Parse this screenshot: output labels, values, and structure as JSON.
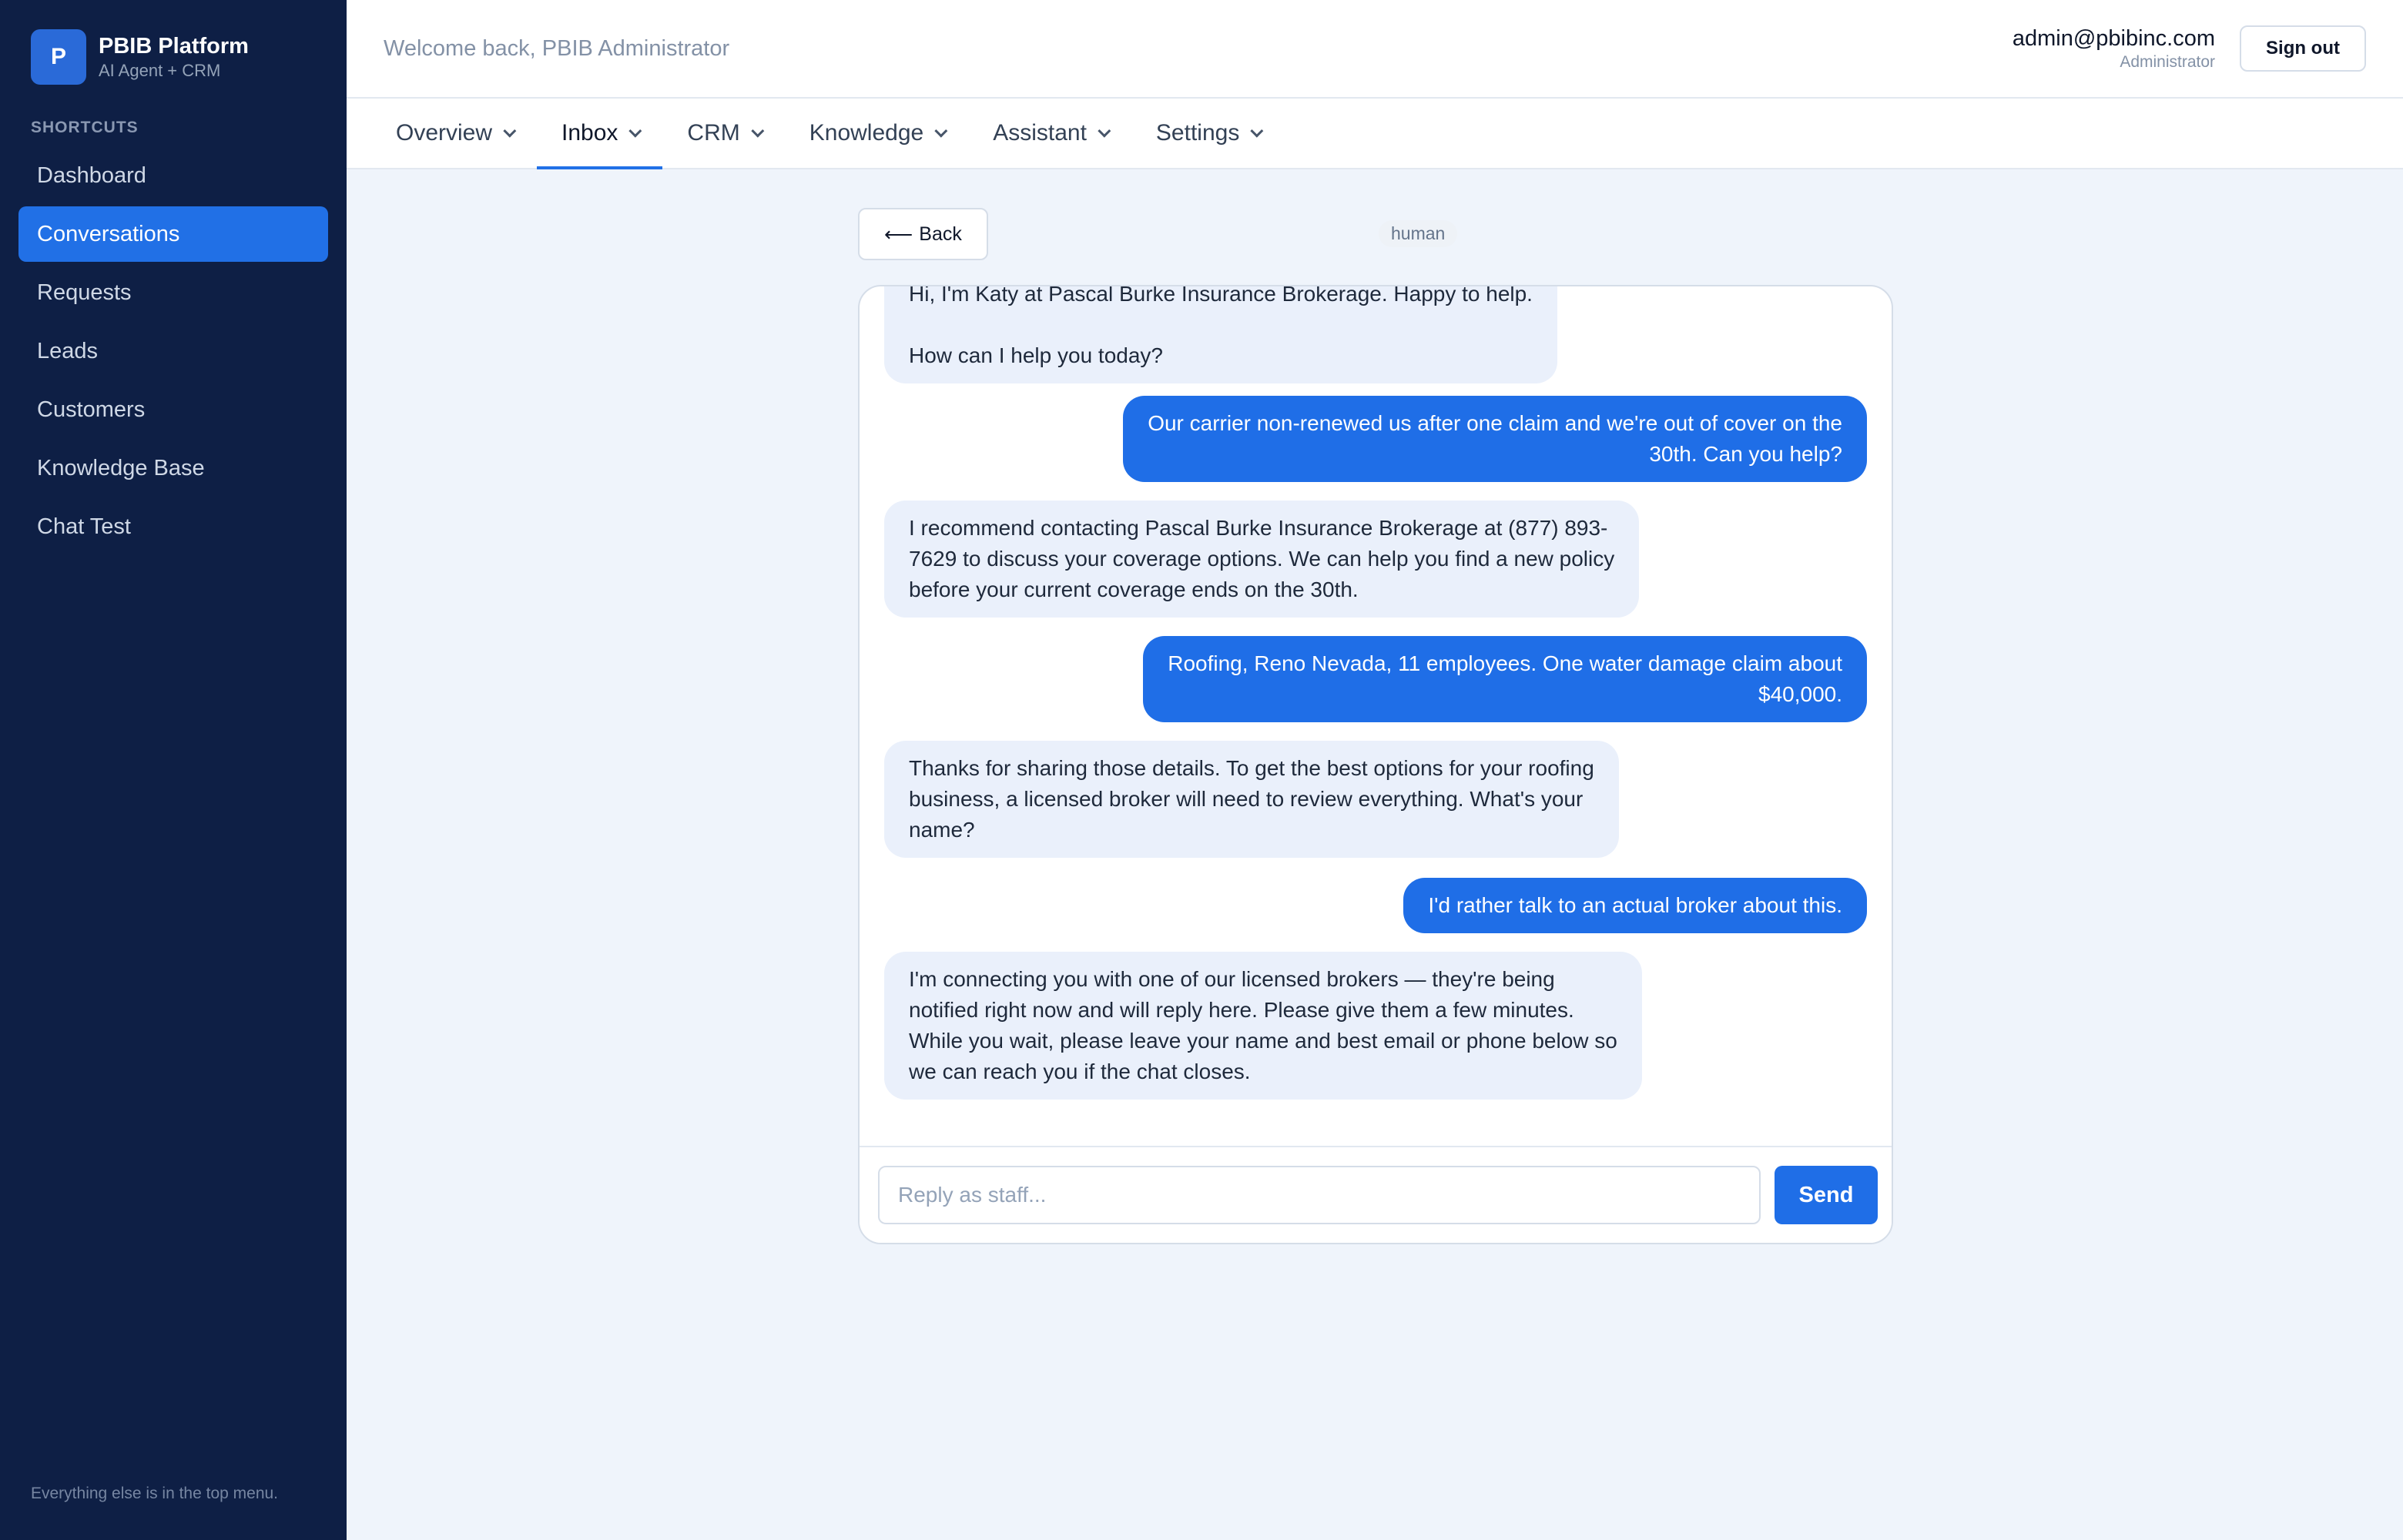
{
  "brand": {
    "logo_letter": "P",
    "title": "PBIB Platform",
    "subtitle": "AI Agent + CRM"
  },
  "sidebar": {
    "heading": "SHORTCUTS",
    "items": [
      {
        "label": "Dashboard",
        "active": false
      },
      {
        "label": "Conversations",
        "active": true
      },
      {
        "label": "Requests",
        "active": false
      },
      {
        "label": "Leads",
        "active": false
      },
      {
        "label": "Customers",
        "active": false
      },
      {
        "label": "Knowledge Base",
        "active": false
      },
      {
        "label": "Chat Test",
        "active": false
      }
    ],
    "footer": "Everything else is in the top menu."
  },
  "header": {
    "welcome": "Welcome back, PBIB Administrator",
    "user_email": "admin@pbibinc.com",
    "user_role": "Administrator",
    "signout_label": "Sign out"
  },
  "menu": {
    "items": [
      {
        "label": "Overview"
      },
      {
        "label": "Inbox"
      },
      {
        "label": "CRM"
      },
      {
        "label": "Knowledge"
      },
      {
        "label": "Assistant"
      },
      {
        "label": "Settings"
      }
    ],
    "active": "Inbox"
  },
  "conversation": {
    "back_label": "Back",
    "status": "human",
    "messages": [
      {
        "role": "bot",
        "lines": [
          "Hi, I'm Katy at Pascal Burke Insurance Brokerage. Happy to help.",
          "",
          "How can I help you today?"
        ]
      },
      {
        "role": "user",
        "lines": [
          "Our carrier non-renewed us after one claim and we're out of cover on the",
          "30th. Can you help?"
        ]
      },
      {
        "role": "bot",
        "lines": [
          "I recommend contacting Pascal Burke Insurance Brokerage at (877) 893-",
          "7629 to discuss your coverage options. We can help you find a new policy",
          "before your current coverage ends on the 30th."
        ]
      },
      {
        "role": "user",
        "lines": [
          "Roofing, Reno Nevada, 11 employees. One water damage claim about",
          "$40,000."
        ]
      },
      {
        "role": "bot",
        "lines": [
          "Thanks for sharing those details. To get the best options for your roofing",
          "business, a licensed broker will need to review everything. What's your",
          "name?"
        ]
      },
      {
        "role": "user",
        "lines": [
          "I'd rather talk to an actual broker about this."
        ]
      },
      {
        "role": "bot",
        "lines": [
          "I'm connecting you with one of our licensed brokers — they're being",
          "notified right now and will reply here. Please give them a few minutes.",
          "While you wait, please leave your name and best email or phone below so",
          "we can reach you if the chat closes."
        ]
      }
    ],
    "reply_placeholder": "Reply as staff...",
    "reply_value": "",
    "send_label": "Send"
  },
  "colors": {
    "sidebar_bg": "#0e1f45",
    "accent": "#2170e6",
    "bot_bubble": "#eaf0fb",
    "page_bg": "#eff4fb"
  }
}
